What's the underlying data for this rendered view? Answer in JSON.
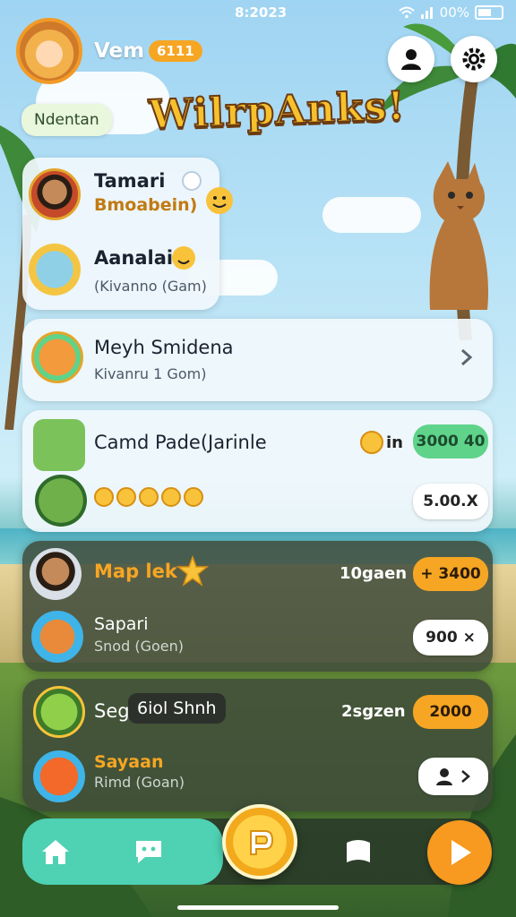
{
  "status_bar": {
    "time": "8:2023",
    "battery": "00%"
  },
  "header": {
    "username": "Vem",
    "level": "6111",
    "tag": "Ndentan",
    "title": "WilrpAnks!"
  },
  "cards": [
    {
      "name": "Tamari",
      "sub_highlight": "Bmoabein)",
      "name2": "Aanalai",
      "sub2": "(Kivanno (Gam)"
    },
    {
      "name": "Meyh Smidena",
      "sub": "Kivanru 1 Gom)"
    },
    {
      "name": "Camd Pade(Jarinle",
      "meta": "in",
      "pill_top": "3000 40",
      "pill_bottom": "5.00.X"
    },
    {
      "name": "Map lek",
      "meta": "10gaen",
      "pill_top": "+ 3400",
      "name2": "Sapari",
      "sub2": "Snod (Goen)",
      "pill_bottom": "900 ×"
    },
    {
      "name": "Seg",
      "chip": "6iol Shnh",
      "meta": "2sgzen",
      "pill_top": "2000",
      "name2": "Sayaan",
      "sub2": "Rimd (Goan)"
    }
  ],
  "colors": {
    "accent_orange": "#f6a623",
    "accent_green": "#5fd38a",
    "nav_teal": "#4fd1b3"
  }
}
